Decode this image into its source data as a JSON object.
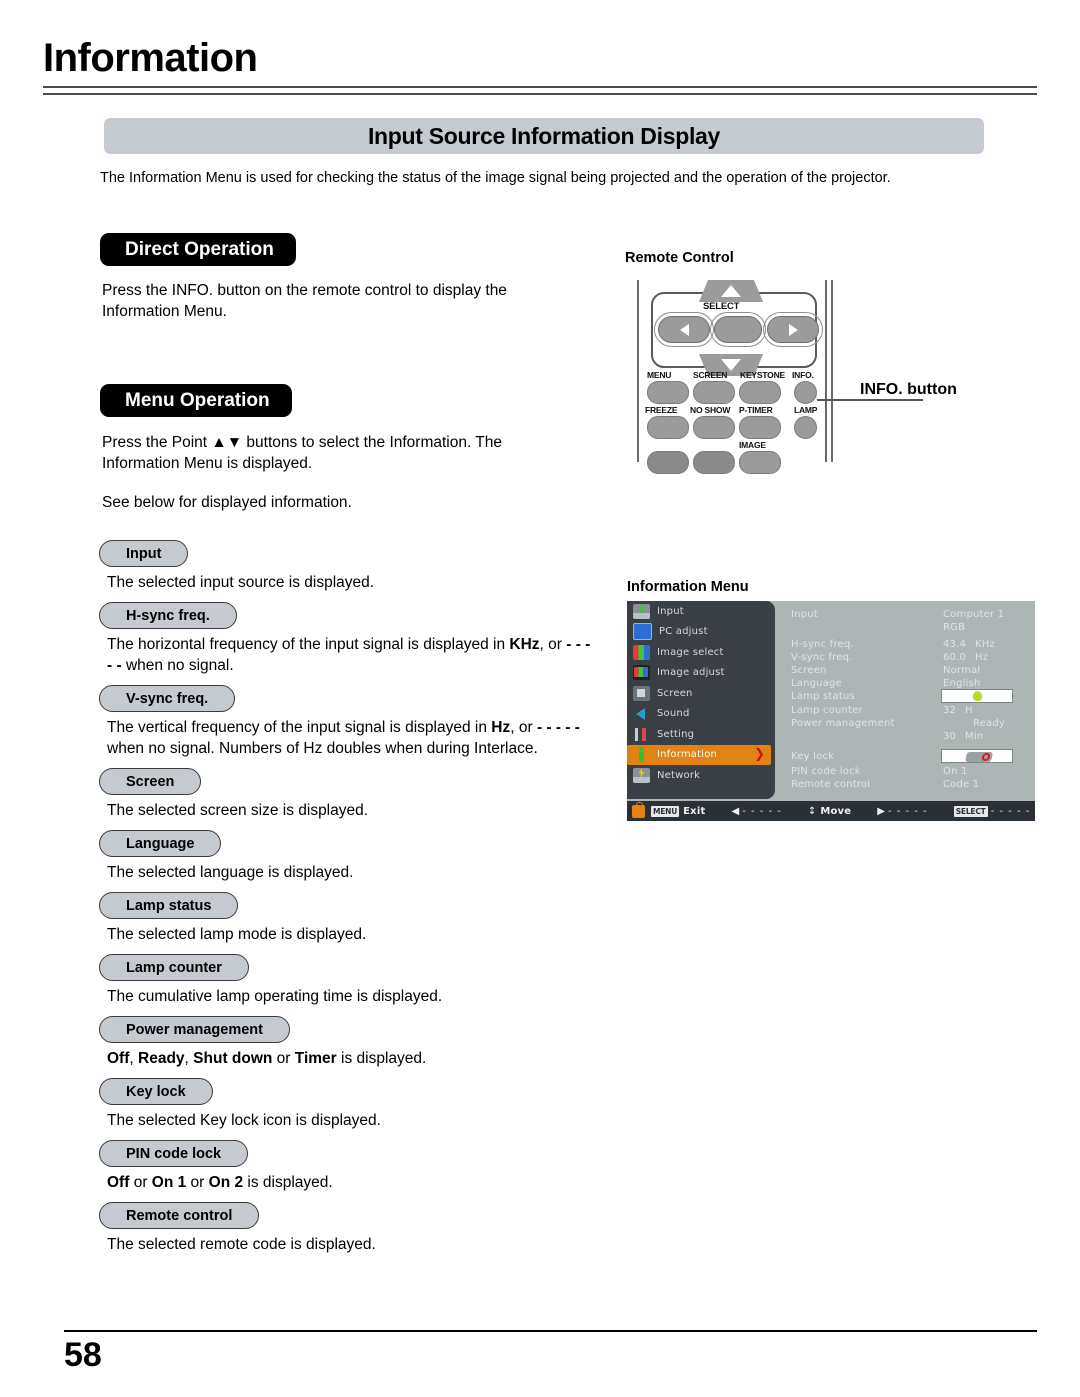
{
  "header": {
    "title": "Information"
  },
  "section": {
    "title": "Input Source Information Display",
    "intro": "The Information Menu is used for checking the status of the image signal being projected and the operation of the projector."
  },
  "direct_operation": {
    "tag": "Direct Operation",
    "text": "Press the INFO. button on the remote control to display the Information Menu."
  },
  "menu_operation": {
    "tag": "Menu Operation",
    "text1": "Press the Point ▲▼ buttons to select the Information. The Information Menu is displayed.",
    "text2": "See below for displayed information."
  },
  "specs": [
    {
      "label": "Input",
      "desc": "The selected input source is displayed."
    },
    {
      "label": "H-sync freq.",
      "desc": "The horizontal frequency of the input signal is displayed in KHz, or - - - - - when no signal."
    },
    {
      "label": "V-sync freq.",
      "desc": "The vertical frequency of the input signal is displayed in Hz, or - - - - -  when no signal. Numbers of Hz doubles when during Interlace."
    },
    {
      "label": "Screen",
      "desc": "The selected screen size is displayed."
    },
    {
      "label": "Language",
      "desc": "The selected language is displayed."
    },
    {
      "label": "Lamp status",
      "desc": "The selected lamp mode is displayed."
    },
    {
      "label": "Lamp counter",
      "desc": "The cumulative lamp operating time is displayed."
    },
    {
      "label": "Power management",
      "desc": "Off, Ready, Shut down or Timer is displayed."
    },
    {
      "label": "Key lock",
      "desc": "The selected Key lock icon is displayed."
    },
    {
      "label": "PIN code lock",
      "desc": "Off or On 1 or On 2 is displayed."
    },
    {
      "label": "Remote control",
      "desc": "The selected remote code  is displayed."
    }
  ],
  "remote": {
    "caption": "Remote Control",
    "select_label": "SELECT",
    "buttons_row1": [
      "MENU",
      "SCREEN",
      "KEYSTONE",
      "INFO."
    ],
    "buttons_row2": [
      "FREEZE",
      "NO SHOW",
      "P-TIMER",
      "LAMP"
    ],
    "image_label": "IMAGE",
    "callout": "INFO. button"
  },
  "info_menu": {
    "caption": "Information Menu",
    "sidebar": [
      {
        "label": "Input",
        "icon": "input-icon",
        "selected": false
      },
      {
        "label": "PC adjust",
        "icon": "pc-adjust-icon",
        "selected": false
      },
      {
        "label": "Image select",
        "icon": "image-select-icon",
        "selected": false
      },
      {
        "label": "Image adjust",
        "icon": "image-adjust-icon",
        "selected": false
      },
      {
        "label": "Screen",
        "icon": "screen-icon",
        "selected": false
      },
      {
        "label": "Sound",
        "icon": "sound-icon",
        "selected": false
      },
      {
        "label": "Setting",
        "icon": "setting-icon",
        "selected": false
      },
      {
        "label": "Information",
        "icon": "information-icon",
        "selected": true
      },
      {
        "label": "Network",
        "icon": "network-icon",
        "selected": false
      }
    ],
    "values": {
      "input_key": "Input",
      "input_val": "Computer 1",
      "input_val2": "RGB",
      "hsync_key": "H-sync freq.",
      "hsync_val": "43.4",
      "hsync_unit": "KHz",
      "vsync_key": "V-sync freq.",
      "vsync_val": "60.0",
      "vsync_unit": "Hz",
      "screen_key": "Screen",
      "screen_val": "Normal",
      "language_key": "Language",
      "language_val": "English",
      "lamp_status_key": "Lamp status",
      "lamp_counter_key": "Lamp counter",
      "lamp_counter_val": "32",
      "lamp_counter_unit": "H",
      "power_mgmt_key": "Power management",
      "power_mgmt_val": "Ready",
      "power_mgmt_time": "30",
      "power_mgmt_time_unit": "Min",
      "key_lock_key": "Key lock",
      "pin_lock_key": "PIN code lock",
      "pin_lock_val": "On 1",
      "remote_key": "Remote control",
      "remote_val": "Code 1"
    },
    "footer": {
      "menu_key": "MENU",
      "exit": "Exit",
      "dash1": "- - - - -",
      "move": "Move",
      "dash2": "- - - - -",
      "select_key": "SELECT",
      "dash3": "- - - - -"
    }
  },
  "footer": {
    "page_number": "58"
  },
  "colors": {
    "accent_orange": "#e08214",
    "menu_dark": "#3a3f45",
    "menu_panel": "#aeb5b5",
    "pill_gray": "#c5cad1"
  }
}
